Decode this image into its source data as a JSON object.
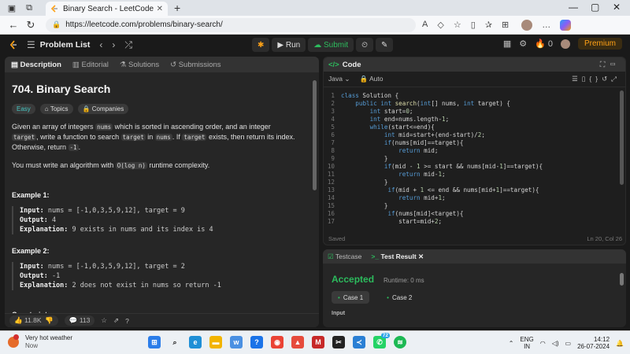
{
  "browser": {
    "tab_title": "Binary Search - LeetCode",
    "url": "https://leetcode.com/problems/binary-search/"
  },
  "header": {
    "problem_list": "Problem List",
    "run": "Run",
    "submit": "Submit",
    "streak": "0",
    "premium": "Premium"
  },
  "left_tabs": [
    "Description",
    "Editorial",
    "Solutions",
    "Submissions"
  ],
  "problem": {
    "title": "704. Binary Search",
    "tags": [
      "Easy",
      "Topics",
      "Companies"
    ],
    "desc_parts": [
      "Given an array of integers ",
      "nums",
      " which is sorted in ascending order, and an integer ",
      "target",
      ", write a function to search ",
      "target",
      " in ",
      "nums",
      ". If ",
      "target",
      " exists, then return its index. Otherwise, return ",
      "-1",
      "."
    ],
    "complexity_parts": [
      "You must write an algorithm with ",
      "O(log n)",
      " runtime complexity."
    ],
    "examples": [
      {
        "title": "Example 1:",
        "input": "nums = [-1,0,3,5,9,12], target = 9",
        "output": "4",
        "explanation": "9 exists in nums and its index is 4"
      },
      {
        "title": "Example 2:",
        "input": "nums = [-1,0,3,5,9,12], target = 2",
        "output": "-1",
        "explanation": "2 does not exist in nums so return -1"
      }
    ],
    "labels": {
      "input": "Input:",
      "output": "Output:",
      "explanation": "Explanation:"
    },
    "constraints": "Constraints:"
  },
  "footer": {
    "likes": "11.8K",
    "comments": "113"
  },
  "code": {
    "title": "Code",
    "language": "Java",
    "mode": "Auto",
    "lines": [
      "class Solution {",
      "    public int search(int[] nums, int target) {",
      "        int start=0;",
      "        int end=nums.length-1;",
      "        while(start<=end){",
      "            int mid=start+(end-start)/2;",
      "            if(nums[mid]==target){",
      "                return mid;",
      "            }",
      "            if(mid - 1 >= start && nums[mid-1]==target){",
      "                return mid-1;",
      "            }",
      "             if(mid + 1 <= end && nums[mid+1]==target){",
      "                return mid+1;",
      "            }",
      "             if(nums[mid]<target){",
      "                start=mid+2;"
    ],
    "status_left": "Saved",
    "status_right": "Ln 20, Col 26"
  },
  "test": {
    "tabs": [
      "Testcase",
      "Test Result"
    ],
    "verdict": "Accepted",
    "runtime": "Runtime: 0 ms",
    "cases": [
      "Case 1",
      "Case 2"
    ],
    "input_label": "Input"
  },
  "taskbar": {
    "weather_title": "Very hot weather",
    "weather_sub": "Now",
    "lang_top": "ENG",
    "lang_bottom": "IN",
    "time": "14:12",
    "date": "26-07-2024",
    "whatsapp_badge": "72"
  },
  "colors": {
    "accent_green": "#2cbb5d",
    "premium_orange": "#ffa116",
    "easy_teal": "#46c6c2"
  }
}
